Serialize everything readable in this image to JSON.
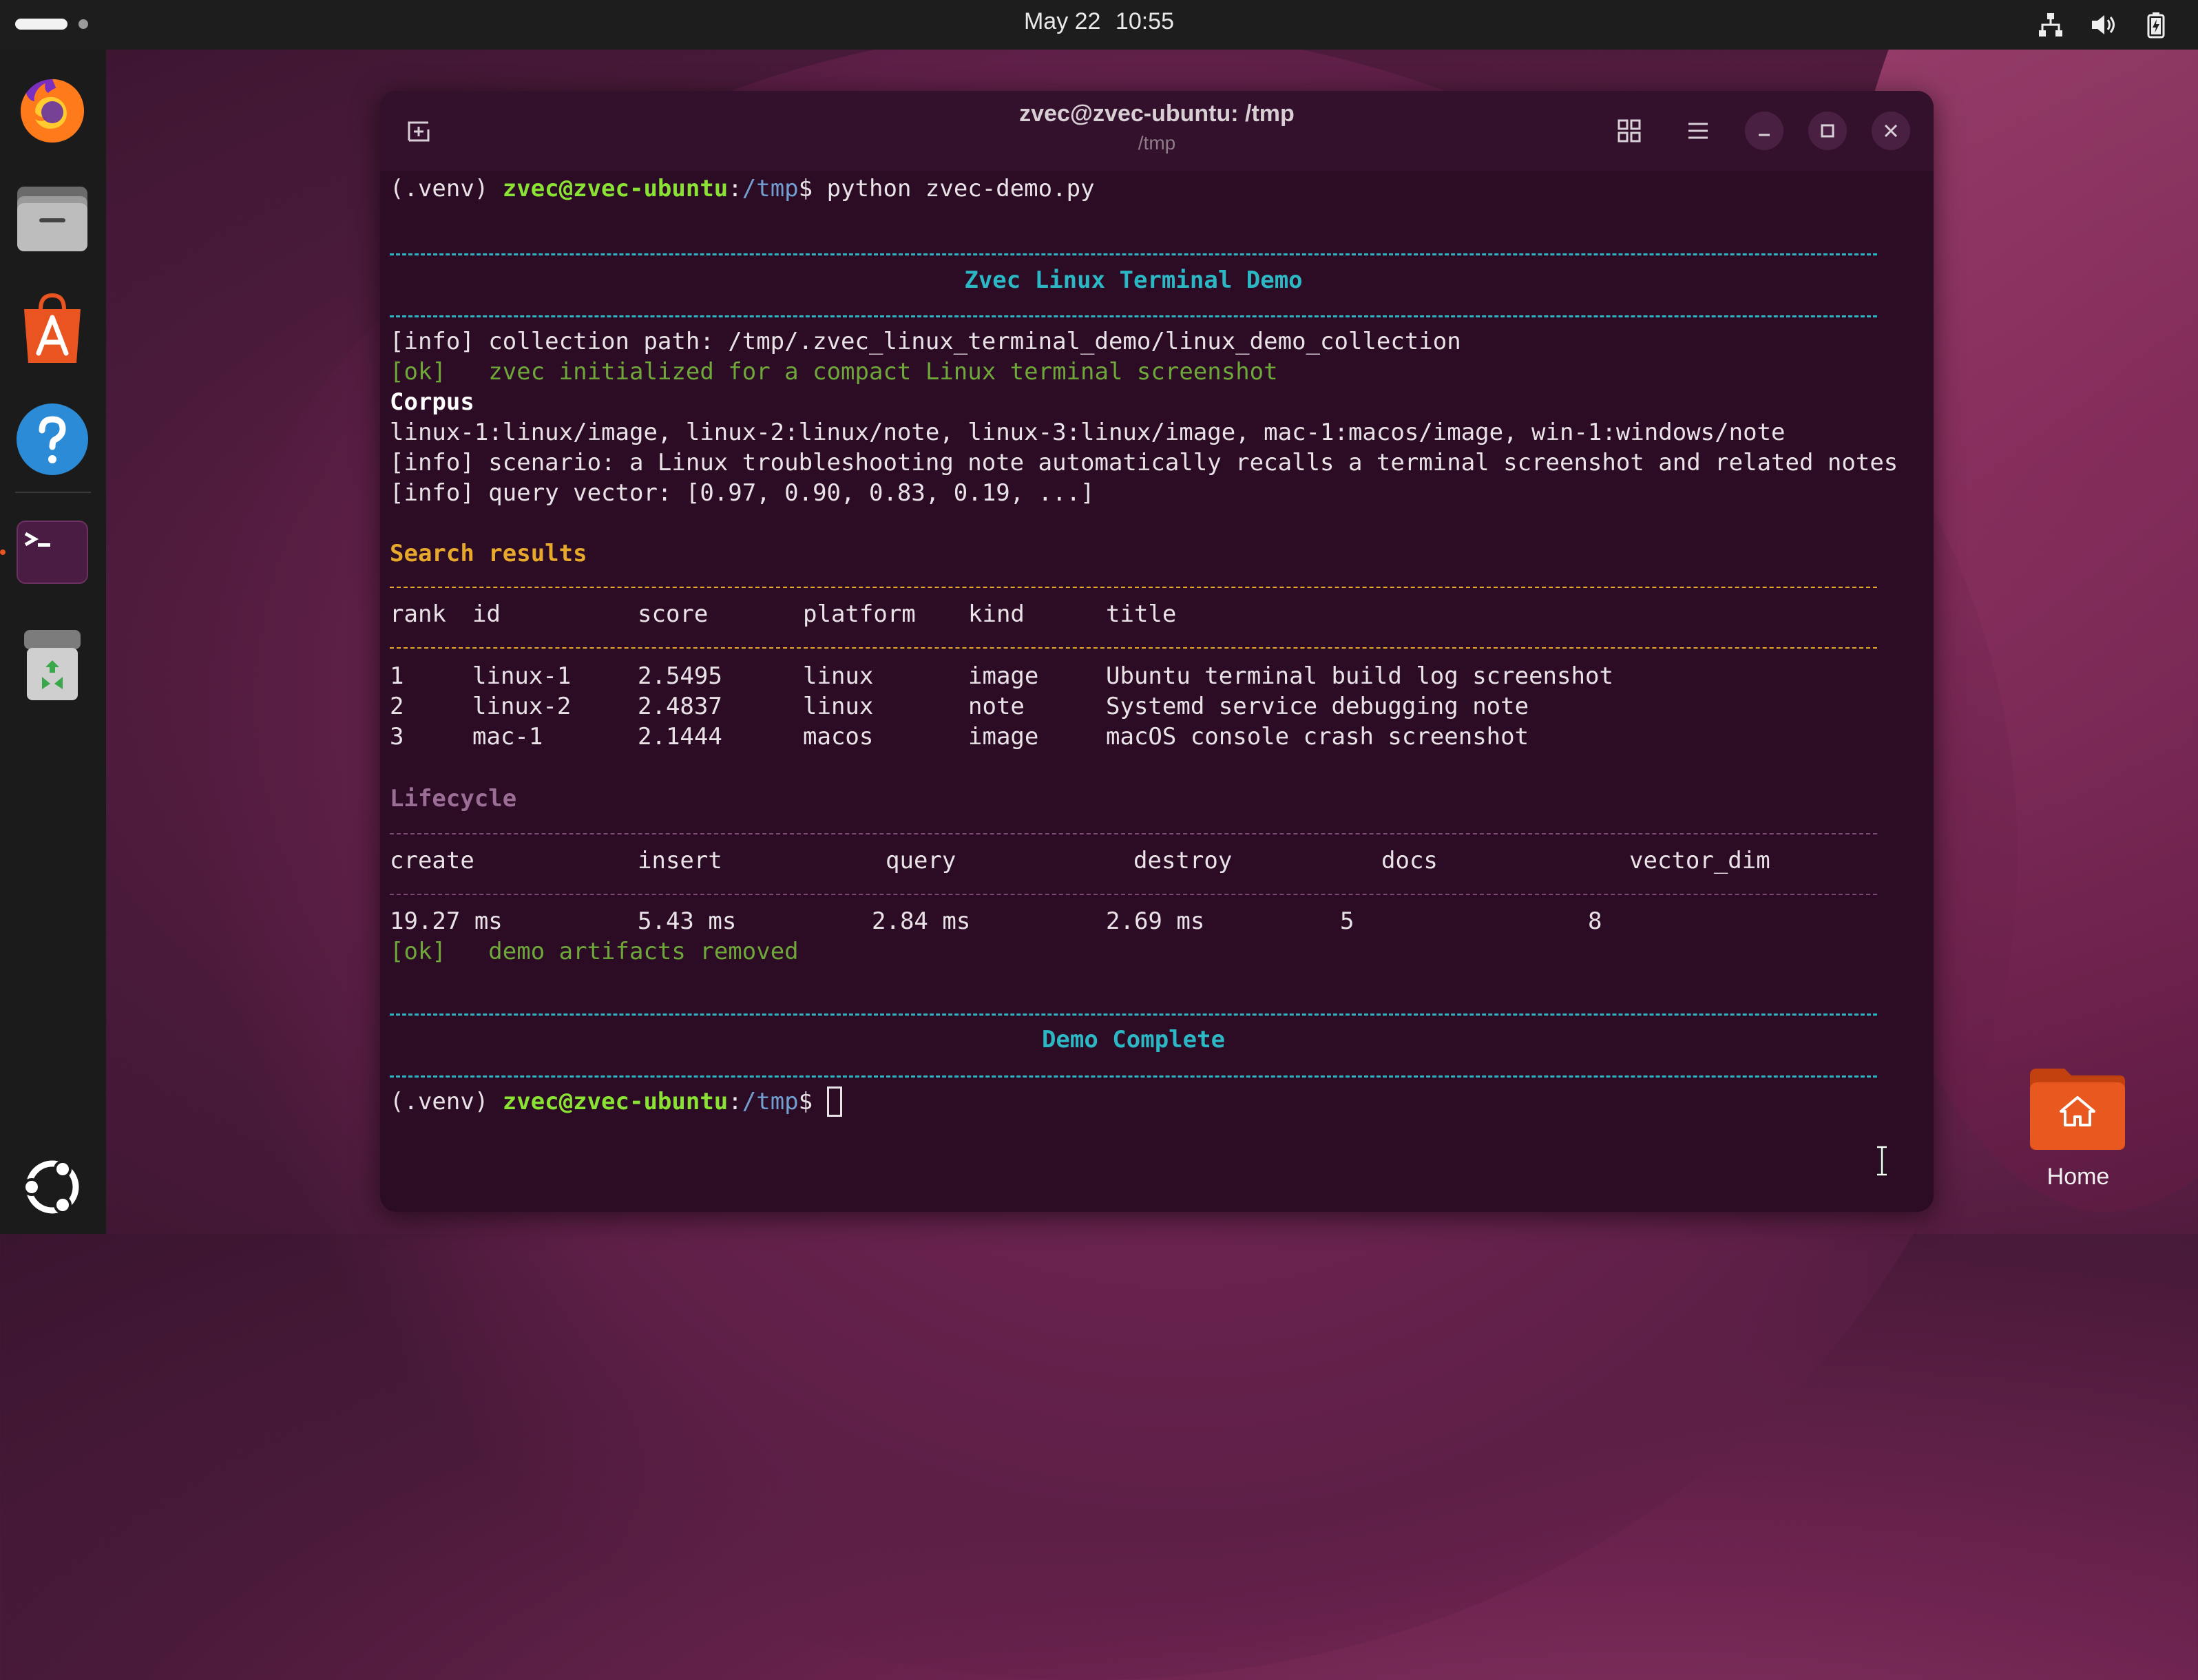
{
  "topbar": {
    "date": "May 22",
    "time": "10:55",
    "tray_icons": [
      "network-icon",
      "volume-icon",
      "battery-icon"
    ]
  },
  "dock": {
    "items": [
      {
        "name": "firefox",
        "icon": "firefox-icon"
      },
      {
        "name": "files",
        "icon": "files-icon"
      },
      {
        "name": "app-center",
        "icon": "app-center-icon"
      },
      {
        "name": "help",
        "icon": "help-icon"
      },
      {
        "name": "terminal",
        "icon": "terminal-icon",
        "running": true
      },
      {
        "name": "trash",
        "icon": "trash-icon"
      },
      {
        "name": "show-apps",
        "icon": "ubuntu-logo-icon"
      }
    ]
  },
  "window": {
    "title": "zvec@zvec-ubuntu: /tmp",
    "subtitle": "/tmp"
  },
  "terminal": {
    "venv": "(.venv) ",
    "user_host": "zvec@zvec-ubuntu",
    "colon": ":",
    "path": "/tmp",
    "dollar": "$ ",
    "command": "python zvec-demo.py",
    "eq_rule": "==============================================================================================================================",
    "banner_title": "Zvec Linux Terminal Demo",
    "info_path": "[info] collection path: /tmp/.zvec_linux_terminal_demo/linux_demo_collection",
    "ok_tag": "[ok]",
    "ok_init": "   zvec initialized for a compact Linux terminal screenshot",
    "corpus_heading": "Corpus",
    "corpus_line": "linux-1:linux/image, linux-2:linux/note, linux-3:linux/image, mac-1:macos/image, win-1:windows/note",
    "info_scenario": "[info] scenario: a Linux troubleshooting note automatically recalls a terminal screenshot and related notes",
    "info_query": "[info] query vector: [0.97, 0.90, 0.83, 0.19, ...]",
    "search_heading": "Search results",
    "results_headers": [
      "rank",
      "id",
      "score",
      "platform",
      "kind",
      "title"
    ],
    "results": [
      {
        "rank": "1",
        "id": "linux-1",
        "score": "2.5495",
        "platform": "linux",
        "kind": "image",
        "title": "Ubuntu terminal build log screenshot"
      },
      {
        "rank": "2",
        "id": "linux-2",
        "score": "2.4837",
        "platform": "linux",
        "kind": "note",
        "title": "Systemd service debugging note"
      },
      {
        "rank": "3",
        "id": "mac-1",
        "score": "2.1444",
        "platform": "macos",
        "kind": "image",
        "title": "macOS console crash screenshot"
      }
    ],
    "lifecycle_heading": "Lifecycle",
    "lifecycle_headers": [
      "create",
      "insert",
      "query",
      "destroy",
      "docs",
      "vector_dim"
    ],
    "lifecycle_values": [
      "19.27 ms",
      "5.43 ms",
      "2.84 ms",
      "2.69 ms",
      "5",
      "8"
    ],
    "ok_removed": "   demo artifacts removed",
    "complete_title": "Demo Complete"
  },
  "desktop": {
    "home_label": "Home"
  }
}
